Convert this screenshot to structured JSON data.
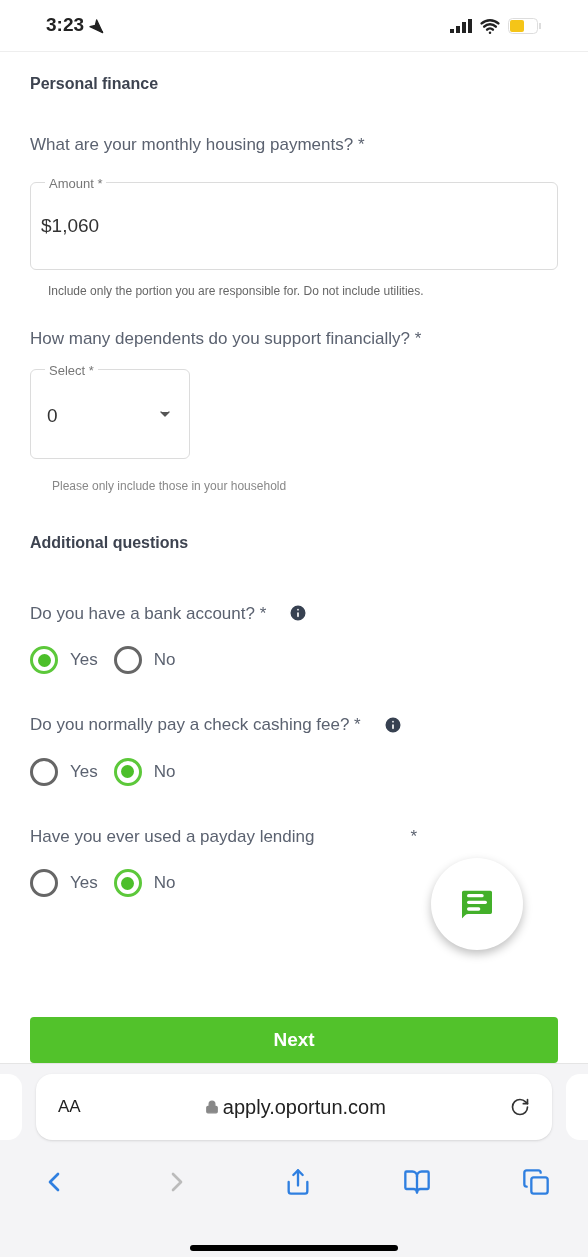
{
  "status_bar": {
    "time": "3:23"
  },
  "section_personal": {
    "title": "Personal finance"
  },
  "housing": {
    "question": "What are your monthly housing payments? *",
    "field_label": "Amount *",
    "value": "$1,060",
    "helper": "Include only the portion you are responsible for. Do not include utilities."
  },
  "dependents": {
    "question": "How many dependents do you support financially? *",
    "field_label": "Select *",
    "value": "0",
    "helper": "Please only include those in your household"
  },
  "section_additional": {
    "title": "Additional questions"
  },
  "questions": [
    {
      "text": "Do you have a bank account? *",
      "info": true,
      "options": [
        {
          "label": "Yes",
          "selected": true
        },
        {
          "label": "No",
          "selected": false
        }
      ]
    },
    {
      "text": "Do you normally pay a check cashing fee? *",
      "info": true,
      "options": [
        {
          "label": "Yes",
          "selected": false
        },
        {
          "label": "No",
          "selected": true
        }
      ]
    },
    {
      "text": "Have you ever used a payday lending",
      "trailing": "*",
      "info": false,
      "options": [
        {
          "label": "Yes",
          "selected": false
        },
        {
          "label": "No",
          "selected": true
        }
      ]
    }
  ],
  "next_button": {
    "label": "Next"
  },
  "browser": {
    "text_size": "AA",
    "url": "apply.oportun.com",
    "forward_disabled": true
  }
}
